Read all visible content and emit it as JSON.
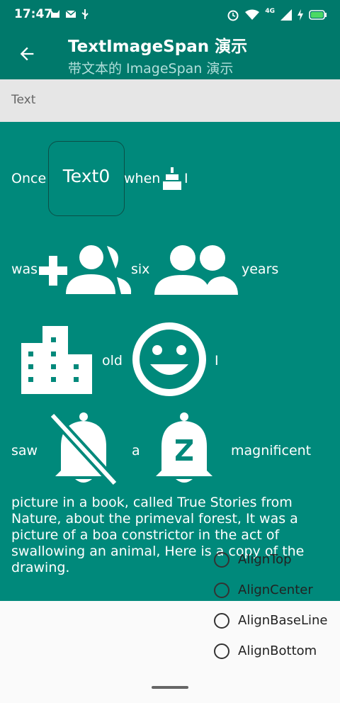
{
  "status_bar": {
    "time": "17:47",
    "left_icons": [
      "cat-icon",
      "mail-icon",
      "usb-icon"
    ],
    "right_icons": [
      "alarm-icon",
      "wifi-icon",
      "signal-icon",
      "charging-icon",
      "battery-icon"
    ],
    "network": "4G"
  },
  "app_bar": {
    "title": "TextImageSpan 演示",
    "subtitle": "带文本的 ImageSpan 演示"
  },
  "section": {
    "label": "Text"
  },
  "content": {
    "line1": {
      "w1": "Once",
      "box": "Text0",
      "w2": "when",
      "w3": "I"
    },
    "line2": {
      "w1": "was",
      "w2": "six",
      "w3": "years"
    },
    "line3": {
      "w1": "old",
      "w2": "I"
    },
    "line4": {
      "w1": "saw",
      "w2": "a",
      "w3": "magnificent"
    },
    "paragraph": "picture in a book, called True Stories from Nature, about the primeval forest, It was a picture of a boa constrictor in the act of swallowing an animal, Here is a copy of the drawing."
  },
  "radio_options": [
    "AlignTop",
    "AlignCenter",
    "AlignBaseLine",
    "AlignBottom"
  ],
  "colors": {
    "primary": "#00796b",
    "content_bg": "#00897b",
    "subtitle": "#b2dfdb"
  }
}
